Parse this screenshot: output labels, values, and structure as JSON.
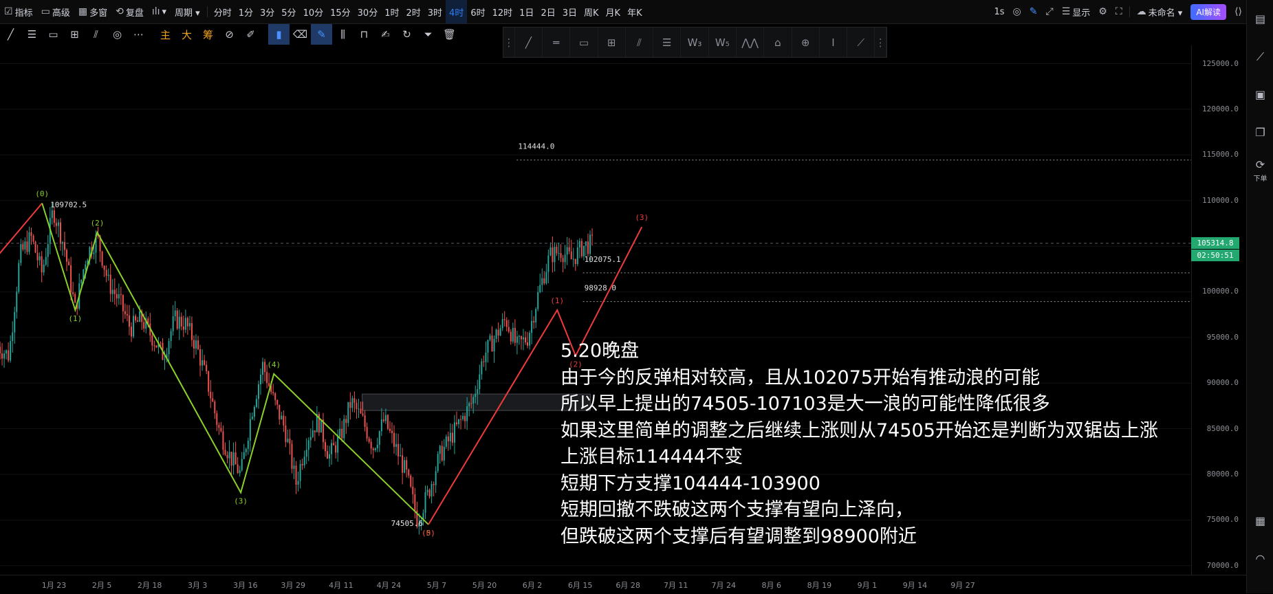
{
  "topbar": {
    "left_items": [
      {
        "icon": "☑",
        "label": "指标"
      },
      {
        "icon": "▭",
        "label": "高级"
      },
      {
        "icon": "▦",
        "label": "多窗"
      },
      {
        "icon": "⟲",
        "label": "复盘"
      },
      {
        "icon": "ılı",
        "label": "▾"
      },
      {
        "icon": "",
        "label": "周期 ▾"
      }
    ],
    "periods": [
      "分时",
      "1分",
      "3分",
      "5分",
      "10分",
      "15分",
      "30分",
      "1时",
      "2时",
      "3时",
      "4时",
      "6时",
      "12时",
      "1日",
      "2日",
      "3日",
      "周K",
      "月K",
      "年K"
    ],
    "active_period": "4时",
    "right": {
      "interval": "1s",
      "display_label": "显示",
      "layout_name": "未命名 ▾",
      "ai_label": "AI解读"
    }
  },
  "toolbar2": {
    "text_tools": [
      "主",
      "大",
      "筹"
    ]
  },
  "annotation": {
    "lines": [
      "5.20晚盘",
      "由于今的反弹相对较高，且从102075开始有推动浪的可能",
      "所以早上提出的74505-107103是大一浪的可能性降低很多",
      "如果这里简单的调整之后继续上涨则从74505开始还是判断为双锯齿上涨",
      "上涨目标114444不变",
      "短期下方支撑104444-103900",
      "短期回撤不跌破这两个支撑有望向上泽向，",
      "但跌破这两个支撑后有望调整到98900附近"
    ]
  },
  "right_sidebar": {
    "order_label": "下单"
  },
  "chart_data": {
    "type": "candlestick",
    "interval": "4时",
    "last_price": "105314.8",
    "countdown": "02:50:51",
    "ylim": [
      69000,
      127000
    ],
    "y_ticks": [
      "125000.0",
      "120000.0",
      "115000.0",
      "110000.0",
      "105000.0",
      "100000.0",
      "95000.0",
      "90000.0",
      "85000.0",
      "80000.0",
      "75000.0",
      "70000.0"
    ],
    "x_ticks": [
      "1月 23",
      "2月 5",
      "2月 18",
      "3月 3",
      "3月 16",
      "3月 29",
      "4月 11",
      "4月 24",
      "5月 7",
      "5月 20",
      "6月 2",
      "6月 15",
      "6月 28",
      "7月 11",
      "7月 24",
      "8月 6",
      "8月 19",
      "9月 1",
      "9月 14",
      "9月 27"
    ],
    "price_path": [
      [
        0,
        94000
      ],
      [
        3,
        93000
      ],
      [
        6,
        104000
      ],
      [
        9,
        106000
      ],
      [
        12,
        102000
      ],
      [
        15,
        109000
      ],
      [
        18,
        105000
      ],
      [
        21,
        98000
      ],
      [
        24,
        104000
      ],
      [
        27,
        106000
      ],
      [
        30,
        101000
      ],
      [
        33,
        99000
      ],
      [
        36,
        96000
      ],
      [
        39,
        97000
      ],
      [
        42,
        95000
      ],
      [
        45,
        93000
      ],
      [
        48,
        97000
      ],
      [
        51,
        96500
      ],
      [
        54,
        94000
      ],
      [
        57,
        90000
      ],
      [
        60,
        85000
      ],
      [
        63,
        82000
      ],
      [
        66,
        80000
      ],
      [
        69,
        87000
      ],
      [
        72,
        92000
      ],
      [
        75,
        88000
      ],
      [
        78,
        85000
      ],
      [
        81,
        79000
      ],
      [
        84,
        84000
      ],
      [
        87,
        86000
      ],
      [
        90,
        82000
      ],
      [
        93,
        84000
      ],
      [
        96,
        88000
      ],
      [
        99,
        86000
      ],
      [
        102,
        83000
      ],
      [
        105,
        86000
      ],
      [
        108,
        83000
      ],
      [
        111,
        80000
      ],
      [
        114,
        75000
      ],
      [
        117,
        78000
      ],
      [
        120,
        82000
      ],
      [
        123,
        84000
      ],
      [
        126,
        86000
      ],
      [
        129,
        88000
      ],
      [
        132,
        93000
      ],
      [
        135,
        95000
      ],
      [
        138,
        97000
      ],
      [
        141,
        94000
      ],
      [
        144,
        95000
      ],
      [
        147,
        100000
      ],
      [
        150,
        104000
      ],
      [
        153,
        104500
      ],
      [
        156,
        103500
      ],
      [
        159,
        105000
      ],
      [
        162,
        105314.8
      ]
    ],
    "horizontal_levels": [
      {
        "label": "114444.0",
        "value": 114444.0,
        "x_start_day": 141
      },
      {
        "label": "102075.1",
        "value": 102075.1,
        "x_start_day": 159
      },
      {
        "label": "98928.0",
        "value": 98928.0,
        "x_start_day": 159
      }
    ],
    "support_zone": {
      "from_day": 99,
      "to_day": 161,
      "low": 87000,
      "high": 88800
    },
    "wave_green": [
      {
        "label": "(0)",
        "day": 12,
        "price": 109702.5
      },
      {
        "label": "(1)",
        "day": 21,
        "price": 98000
      },
      {
        "label": "(2)",
        "day": 27,
        "price": 106500
      },
      {
        "label": "(3)",
        "day": 66,
        "price": 78000
      },
      {
        "label": "(4)",
        "day": 75,
        "price": 91000
      },
      {
        "label": "(5)",
        "day": 117,
        "price": 74505.6
      }
    ],
    "wave_red": [
      {
        "label": "(0)",
        "day": 117,
        "price": 74505.6
      },
      {
        "label": "(1)",
        "day": 152,
        "price": 98000
      },
      {
        "label": "(2)",
        "day": 157,
        "price": 93000
      },
      {
        "label": "(3)",
        "day": 175,
        "price": 107103
      }
    ],
    "red_lead_in": [
      [
        -1,
        103500
      ],
      [
        12,
        109702.5
      ]
    ],
    "point_labels": [
      {
        "label": "109702.5",
        "day": 12,
        "price": 109702.5
      },
      {
        "label": "74505.6",
        "day": 117,
        "price": 74505.6
      }
    ]
  }
}
